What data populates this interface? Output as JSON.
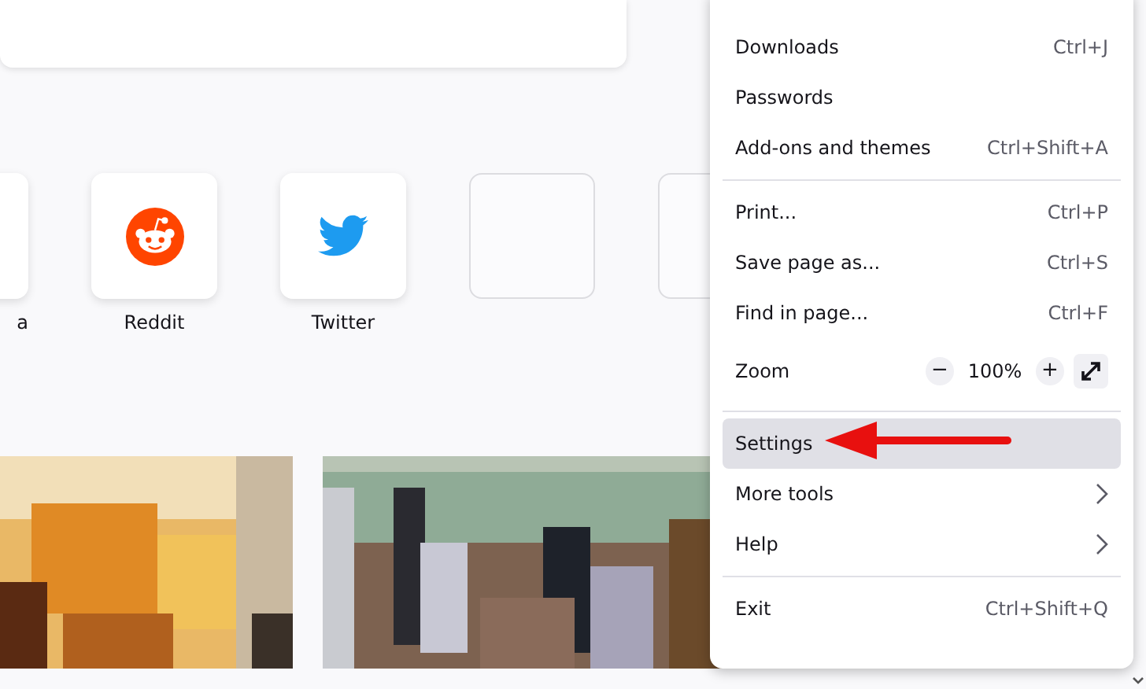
{
  "shortcuts": [
    {
      "kind": "site",
      "label": "a"
    },
    {
      "kind": "site",
      "label": "Reddit"
    },
    {
      "kind": "site",
      "label": "Twitter"
    },
    {
      "kind": "empty"
    },
    {
      "kind": "empty"
    }
  ],
  "menu": {
    "items": [
      {
        "kind": "item",
        "label": "Downloads",
        "shortcut": "Ctrl+J",
        "selected": false
      },
      {
        "kind": "item",
        "label": "Passwords",
        "selected": false
      },
      {
        "kind": "item",
        "label": "Add-ons and themes",
        "shortcut": "Ctrl+Shift+A",
        "selected": false
      },
      {
        "kind": "separator"
      },
      {
        "kind": "item",
        "label": "Print...",
        "shortcut": "Ctrl+P",
        "selected": false
      },
      {
        "kind": "item",
        "label": "Save page as...",
        "shortcut": "Ctrl+S",
        "selected": false
      },
      {
        "kind": "item",
        "label": "Find in page...",
        "shortcut": "Ctrl+F",
        "selected": false
      },
      {
        "kind": "zoom",
        "label": "Zoom",
        "zoom_out": "−",
        "value": "100%",
        "zoom_in": "+"
      },
      {
        "kind": "separator"
      },
      {
        "kind": "item",
        "label": "Settings",
        "selected": true
      },
      {
        "kind": "submenu",
        "label": "More tools",
        "selected": false
      },
      {
        "kind": "submenu",
        "label": "Help",
        "selected": false
      },
      {
        "kind": "separator"
      },
      {
        "kind": "item",
        "label": "Exit",
        "shortcut": "Ctrl+Shift+Q",
        "selected": false
      }
    ]
  }
}
